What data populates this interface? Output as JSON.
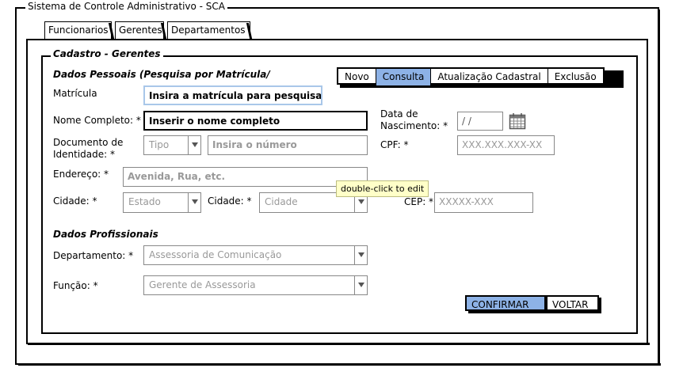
{
  "window": {
    "title": "Sistema de Controle Administrativo - SCA"
  },
  "tabs": [
    {
      "label": "Funcionarios"
    },
    {
      "label": "Gerentes"
    },
    {
      "label": "Departamentos"
    }
  ],
  "fieldset": {
    "legend": "Cadastro - Gerentes"
  },
  "dados_pessoais": {
    "title": "Dados Pessoais (Pesquisa por Matrícula/",
    "matricula_label": "Matrícula",
    "matricula_value": "Insira a matrícula para pesquisar",
    "nome_label": "Nome Completo: *",
    "nome_value": "Inserir o nome completo",
    "nascimento_label_1": "Data de",
    "nascimento_label_2": "Nascimento: *",
    "nascimento_value": "/ /",
    "doc_label_1": "Documento de",
    "doc_label_2": "Identidade: *",
    "doc_tipo": "Tipo",
    "doc_numero_placeholder": "Insira o número",
    "cpf_label": "CPF: *",
    "cpf_placeholder": "XXX.XXX.XXX-XX",
    "endereco_label": "Endereço: *",
    "endereco_placeholder": "Avenida, Rua, etc.",
    "cidade1_label": "Cidade: *",
    "estado_value": "Estado",
    "cidade2_label": "Cidade: *",
    "cidade_value": "Cidade",
    "cep_label": "CEP: *",
    "cep_placeholder": "XXXXX-XXX"
  },
  "mode_buttons": [
    {
      "label": "Novo",
      "selected": false
    },
    {
      "label": "Consulta",
      "selected": true
    },
    {
      "label": "Atualização Cadastral",
      "selected": false
    },
    {
      "label": "Exclusão",
      "selected": false
    }
  ],
  "tooltip": {
    "text": "double-click to edit"
  },
  "dados_profissionais": {
    "title": "Dados Profissionais",
    "departamento_label": "Departamento: *",
    "departamento_value": "Assessoria de Comunicação",
    "funcao_label": "Função: *",
    "funcao_value": "Gerente de Assessoria"
  },
  "actions": {
    "confirm_label": "CONFIRMAR",
    "back_label": "VOLTAR"
  },
  "colors": {
    "selected": "#8db2e6",
    "focus_border": "#a9c7e9",
    "tooltip_bg": "#ffffc8"
  },
  "icons": {
    "calendar": "calendar-icon",
    "dropdown": "chevron-down-icon"
  }
}
